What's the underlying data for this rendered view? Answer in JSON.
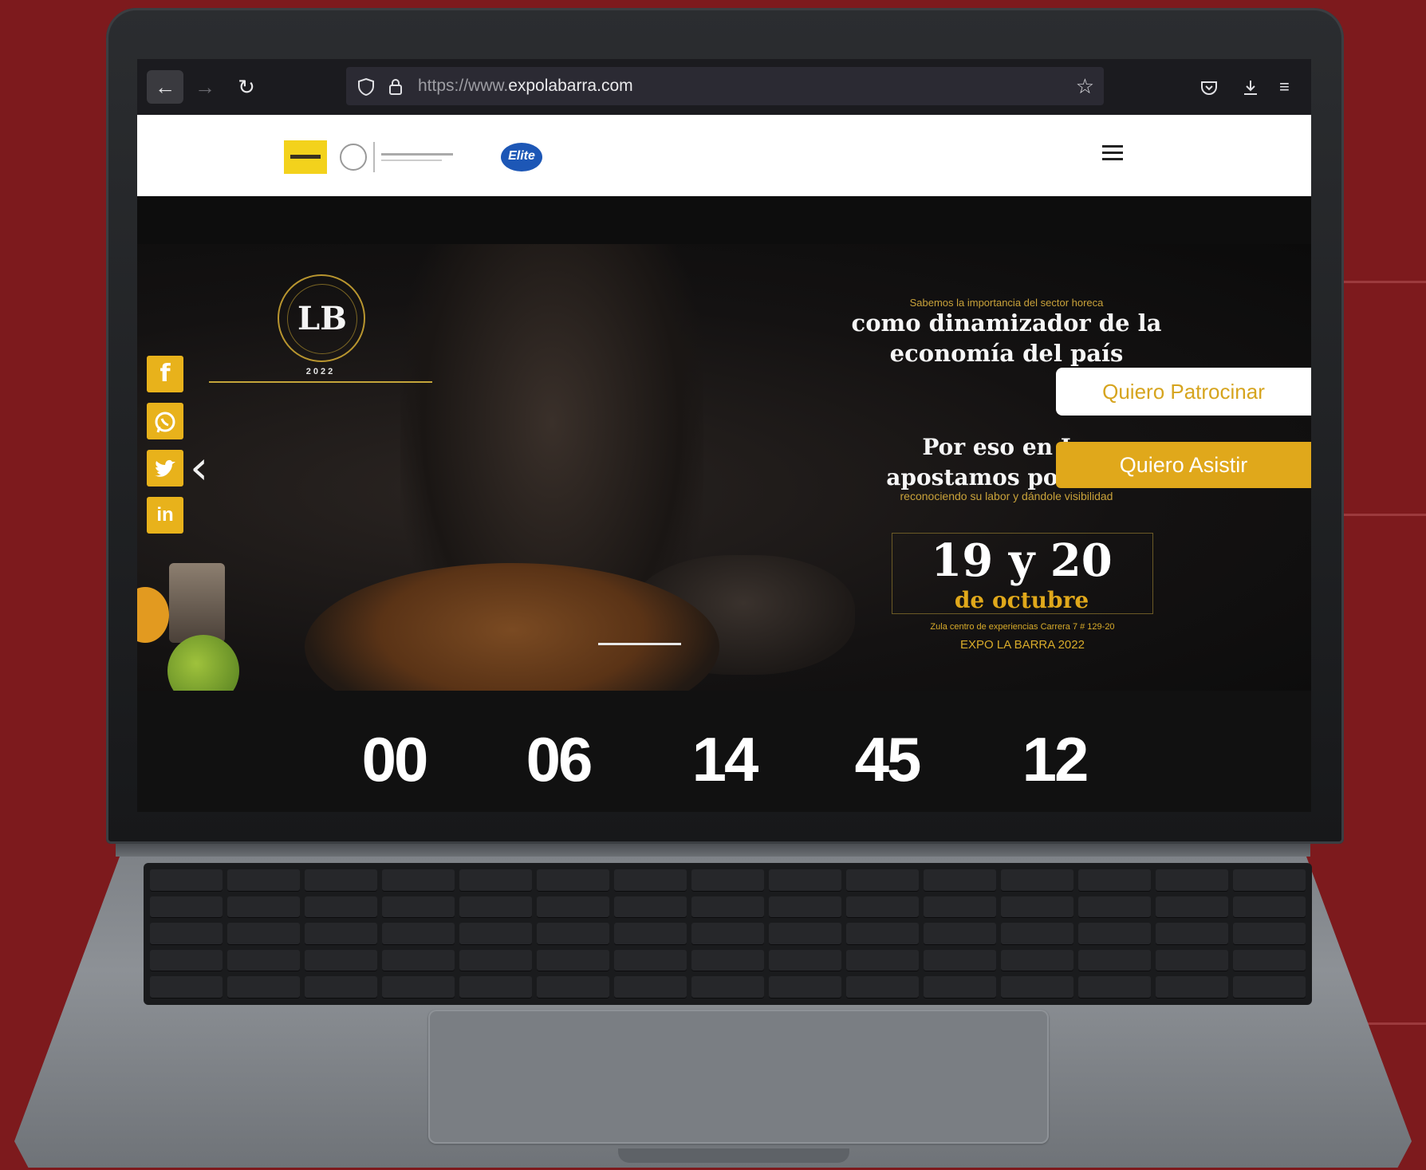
{
  "browser": {
    "url_prefix": "https://www.",
    "url_host": "expolabarra.com",
    "icons": {
      "back": "arrow-left-icon",
      "forward": "arrow-right-icon",
      "reload": "reload-icon",
      "shield": "shield-icon",
      "lock": "lock-icon",
      "bookmark": "star-icon",
      "pocket": "pocket-icon",
      "downloads": "download-icon",
      "menu": "menu-icon"
    }
  },
  "site": {
    "header": {
      "logos": [
        "yellow-partner-logo",
        "seal-logo",
        "elite-logo"
      ],
      "elite_label": "Elite",
      "menu_icon": "hamburger-icon"
    },
    "hero": {
      "brand_year": "2022",
      "tagline_small": "Sabemos la importancia del sector horeca",
      "title_line1": "como dinamizador de la",
      "title_line2": "economía del país",
      "sub_line1": "Por eso en La",
      "sub_line2": "apostamos por su s",
      "sub_small": "reconociendo su labor y dándole visibilidad",
      "cta_sponsor": "Quiero Patrocinar",
      "cta_attend": "Quiero Asistir",
      "date_big": "19 y 20",
      "date_month": "de octubre",
      "venue": "Zula centro de experiencias Carrera 7 # 129-20",
      "event_name": "EXPO LA BARRA 2022",
      "social": [
        "facebook-icon",
        "whatsapp-icon",
        "twitter-icon",
        "linkedin-icon"
      ]
    },
    "countdown": [
      "00",
      "06",
      "14",
      "45",
      "12"
    ]
  },
  "colors": {
    "background": "#7d1a1d",
    "accent_gold": "#e0a81b",
    "hero_dark": "#141212"
  }
}
